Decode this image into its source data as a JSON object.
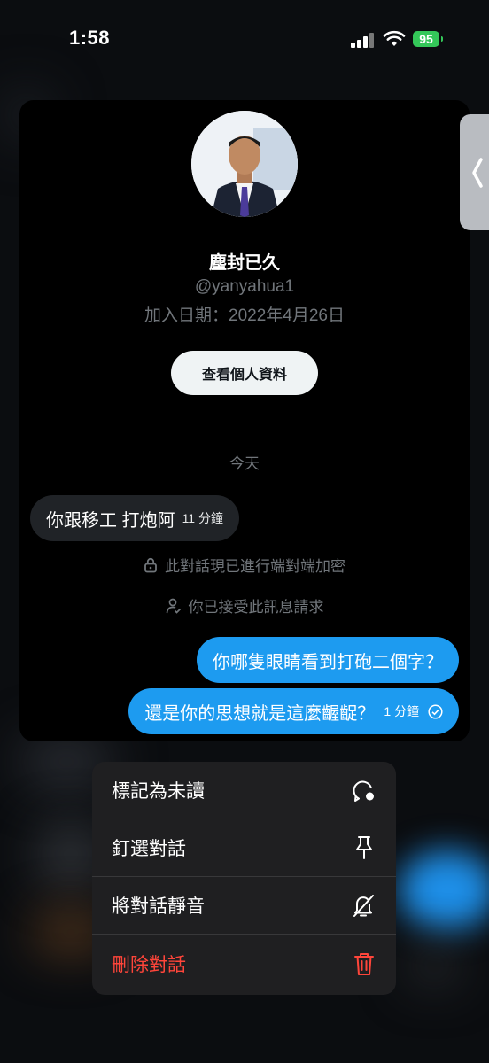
{
  "status_bar": {
    "time": "1:58",
    "battery": "95"
  },
  "profile": {
    "name": "塵封已久",
    "handle": "@yanyahua1",
    "joined": "加入日期：2022年4月26日",
    "view_profile_label": "查看個人資料"
  },
  "conversation": {
    "day_label": "今天",
    "incoming": [
      {
        "text": "你跟移工 打炮阿",
        "time": "11 分鐘"
      }
    ],
    "system": [
      {
        "icon": "lock-icon",
        "text": "此對話現已進行端對端加密"
      },
      {
        "icon": "person-check-icon",
        "text": "你已接受此訊息請求"
      }
    ],
    "outgoing": [
      {
        "text": "你哪隻眼睛看到打砲二個字？"
      },
      {
        "text": "還是你的思想就是這麼齷齪？",
        "time": "1 分鐘"
      }
    ]
  },
  "menu": {
    "items": [
      {
        "label": "標記為未讀",
        "icon": "mark-unread-icon"
      },
      {
        "label": "釘選對話",
        "icon": "pin-icon"
      },
      {
        "label": "將對話靜音",
        "icon": "bell-off-icon"
      },
      {
        "label": "刪除對話",
        "icon": "trash-icon",
        "color": "#ff453a"
      }
    ]
  },
  "colors": {
    "accent": "#1d9bf0",
    "danger": "#ff453a",
    "incoming_bubble": "#202327"
  }
}
